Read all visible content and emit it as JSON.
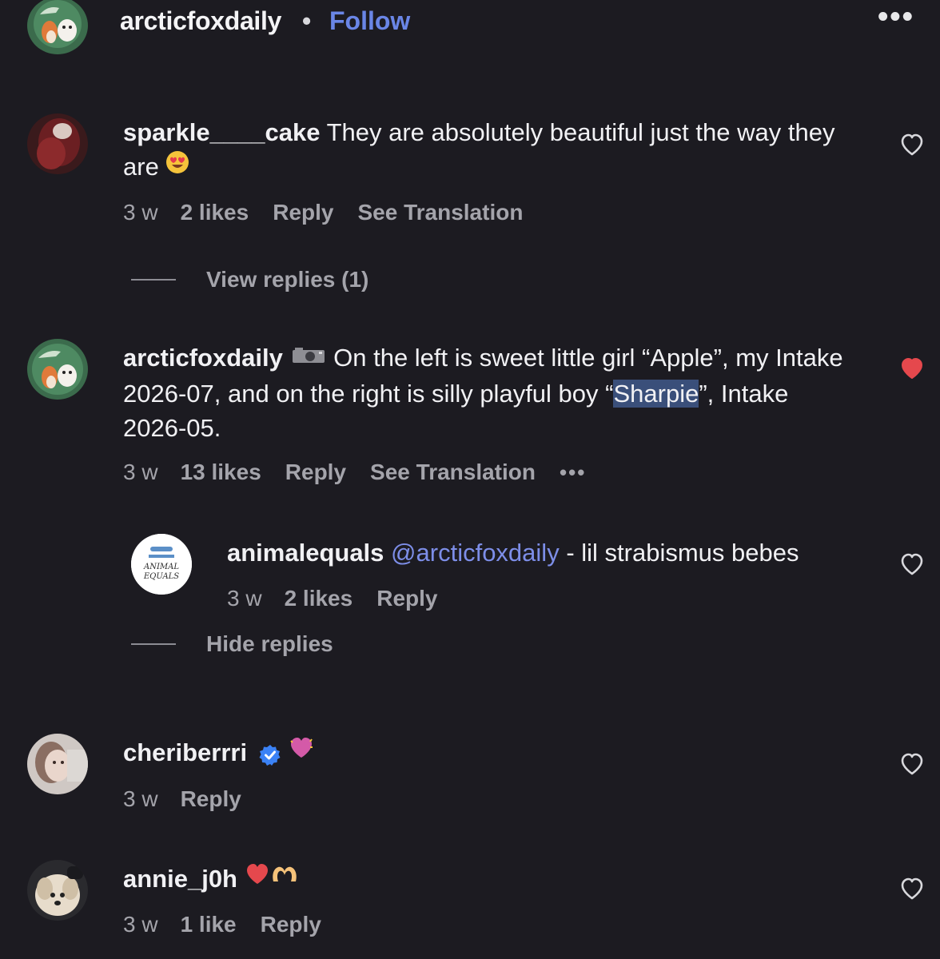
{
  "header": {
    "username": "arcticfoxdaily",
    "separator": "•",
    "follow_label": "Follow",
    "more_label": "•••"
  },
  "comments": [
    {
      "username": "sparkle____cake",
      "text": "They are absolutely beautiful just the way they are",
      "emoji": "heart-eyes-emoji",
      "time": "3 w",
      "likes": "2 likes",
      "reply_label": "Reply",
      "translation_label": "See Translation",
      "replies_toggle": "View replies (1)",
      "liked": false
    },
    {
      "username": "arcticfoxdaily",
      "emoji": "camera-emoji",
      "text_part1": "On the left is sweet little girl “Apple”, my Intake 2026-07, and on the right is silly playful boy “",
      "text_highlight": "Sharpie",
      "text_part2": "”, Intake 2026-05.",
      "time": "3 w",
      "likes": "13 likes",
      "reply_label": "Reply",
      "translation_label": "See Translation",
      "more_label": "•••",
      "liked": true,
      "liked_color": "#e5484d",
      "reply": {
        "username": "animalequals",
        "mention": "@arcticfoxdaily",
        "text": "- lil strabismus bebes",
        "avatar_text_line1": "ANIMAL",
        "avatar_text_line2": "EQUALS",
        "time": "3 w",
        "likes": "2 likes",
        "reply_label": "Reply",
        "liked": false
      },
      "replies_toggle": "Hide replies"
    },
    {
      "username": "cheriberrri",
      "verified": true,
      "emoji": "sparkling-heart-emoji",
      "time": "3 w",
      "reply_label": "Reply",
      "liked": false
    },
    {
      "username": "annie_j0h",
      "emoji": "red-heart-and-heart-hands-emoji",
      "time": "3 w",
      "likes": "1 like",
      "reply_label": "Reply",
      "liked": false
    }
  ],
  "colors": {
    "background": "#1c1b21",
    "link_blue": "#6a86e6",
    "muted_text": "#a4a4ab",
    "liked_red": "#e5484d"
  }
}
